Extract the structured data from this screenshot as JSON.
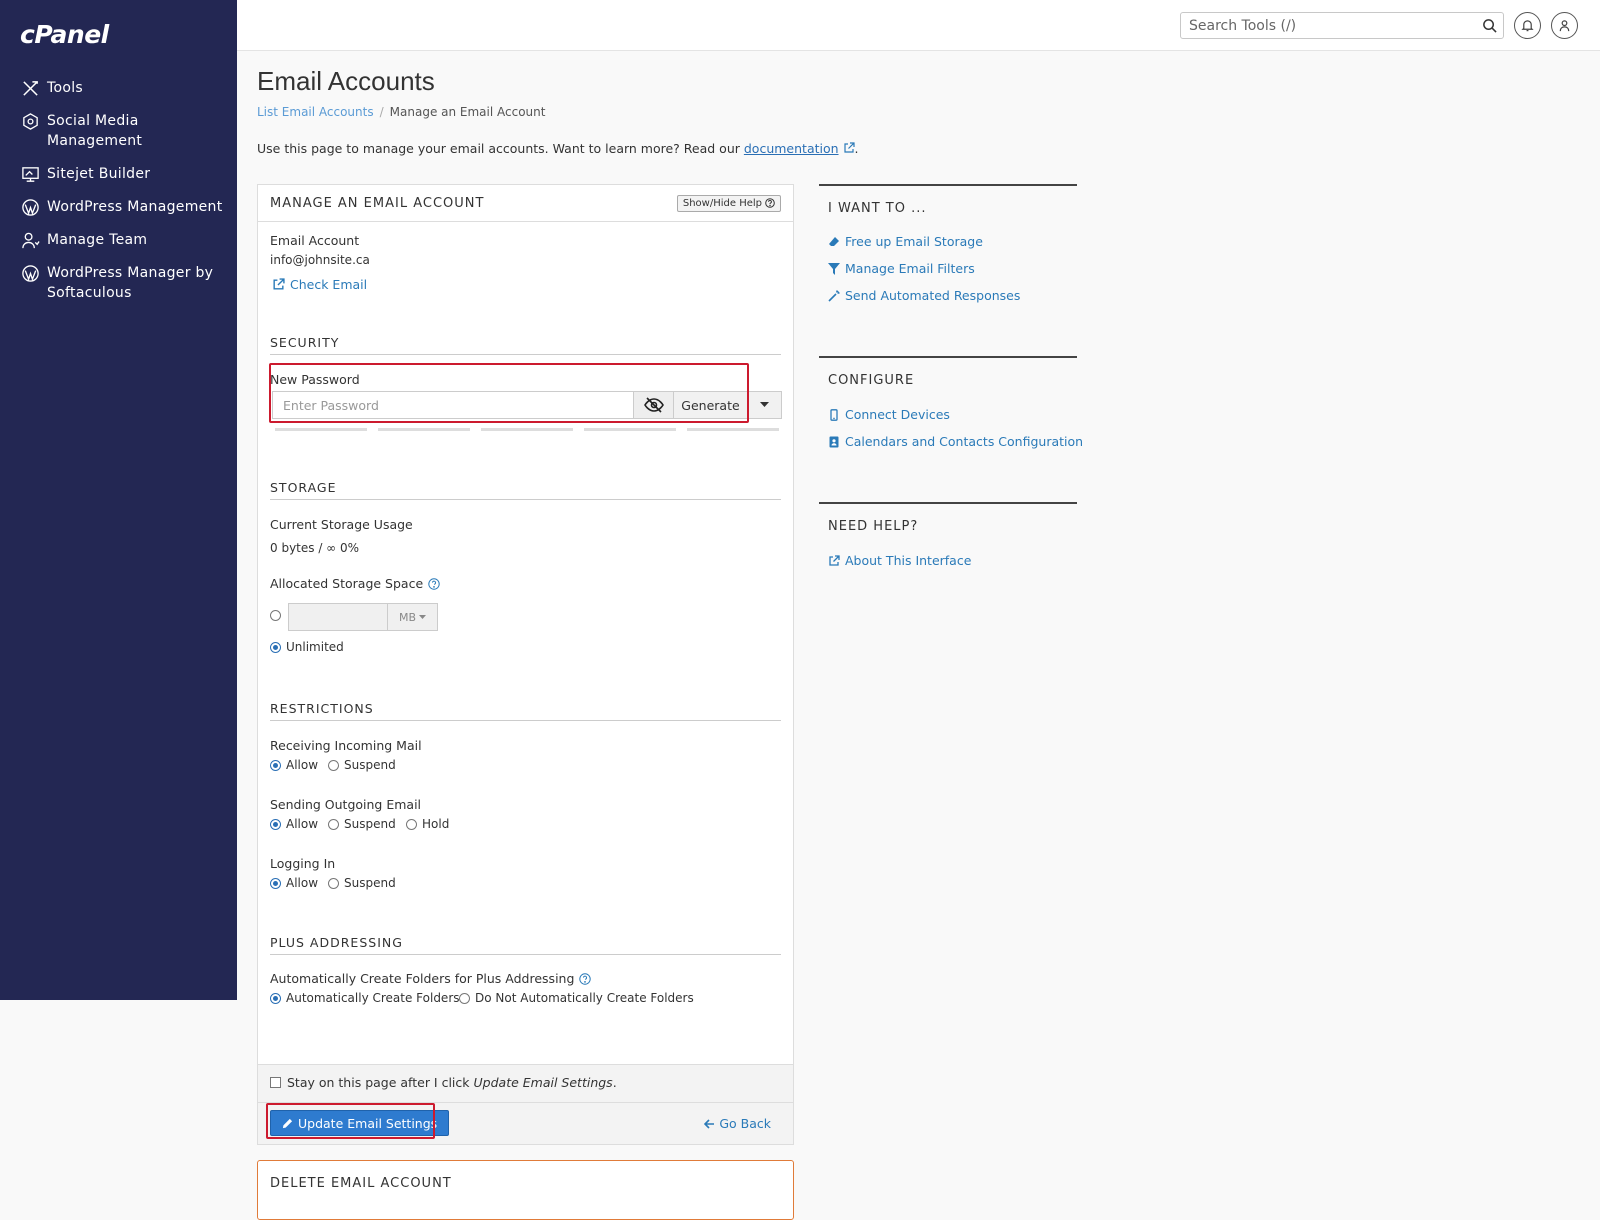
{
  "brand": {
    "logo": "cPanel"
  },
  "sidebar": {
    "items": [
      {
        "label": "Tools",
        "icon": "tools-icon"
      },
      {
        "label": "Social Media Management",
        "icon": "social-media-icon"
      },
      {
        "label": "Sitejet Builder",
        "icon": "sitejet-icon"
      },
      {
        "label": "WordPress Management",
        "icon": "wordpress-icon"
      },
      {
        "label": "Manage Team",
        "icon": "manage-team-icon"
      },
      {
        "label": "WordPress Manager by Softaculous",
        "icon": "wordpress-icon"
      }
    ]
  },
  "topbar": {
    "search_placeholder": "Search Tools (/)"
  },
  "page": {
    "title": "Email Accounts",
    "breadcrumb": {
      "parent": "List Email Accounts",
      "current": "Manage an Email Account"
    },
    "intro": "Use this page to manage your email accounts. Want to learn more? Read our",
    "intro_link": "documentation",
    "intro_end": "."
  },
  "manage": {
    "title": "MANAGE AN EMAIL ACCOUNT",
    "help_button": "Show/Hide Help",
    "account_label": "Email Account",
    "account_value": "info@johnsite.ca",
    "check_email": "Check Email",
    "security": {
      "heading": "SECURITY",
      "password_label": "New Password",
      "password_placeholder": "Enter Password",
      "generate": "Generate"
    },
    "storage": {
      "heading": "STORAGE",
      "usage_label": "Current Storage Usage",
      "usage_value": "0 bytes / ∞ 0%",
      "allocated_label": "Allocated Storage Space",
      "unit": "MB",
      "unlimited": "Unlimited"
    },
    "restrictions": {
      "heading": "RESTRICTIONS",
      "incoming_label": "Receiving Incoming Mail",
      "outgoing_label": "Sending Outgoing Email",
      "login_label": "Logging In",
      "allow": "Allow",
      "suspend": "Suspend",
      "hold": "Hold"
    },
    "plus": {
      "heading": "PLUS ADDRESSING",
      "label": "Automatically Create Folders for Plus Addressing",
      "opt_auto": "Automatically Create Folders",
      "opt_no": "Do Not Automatically Create Folders"
    },
    "footer": {
      "stay_prefix": "Stay on this page after I click",
      "stay_em": "Update Email Settings",
      "stay_suffix": ".",
      "update_button": "Update Email Settings",
      "go_back": "Go Back"
    }
  },
  "delete_panel": {
    "title": "DELETE EMAIL ACCOUNT"
  },
  "side": {
    "want": {
      "title": "I WANT TO ...",
      "links": [
        "Free up Email Storage",
        "Manage Email Filters",
        "Send Automated Responses"
      ]
    },
    "configure": {
      "title": "CONFIGURE",
      "links": [
        "Connect Devices",
        "Calendars and Contacts Configuration"
      ]
    },
    "help": {
      "title": "NEED HELP?",
      "links": [
        "About This Interface"
      ]
    }
  },
  "colors": {
    "sidebar_bg": "#232753",
    "link": "#2a7ab8",
    "primary": "#2e7bcf",
    "highlight": "#cc1a2e",
    "danger_border": "#e07b39"
  }
}
